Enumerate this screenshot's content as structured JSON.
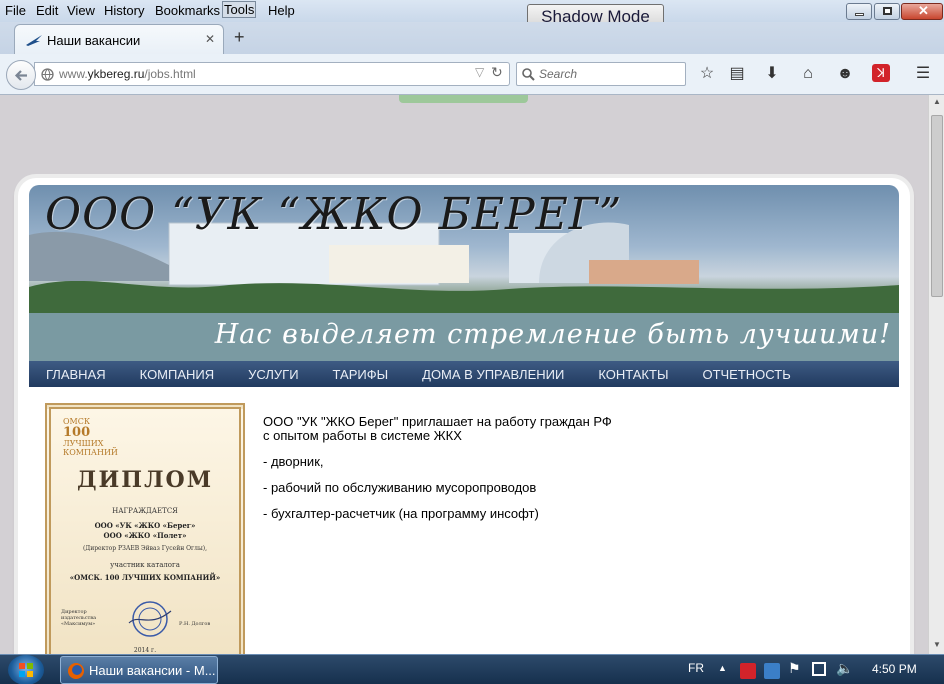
{
  "menu": {
    "items": [
      "File",
      "Edit",
      "View",
      "History",
      "Bookmarks",
      "Tools",
      "Help"
    ],
    "selected": "Tools"
  },
  "shadow_mode_label": "Shadow Mode",
  "tab": {
    "title": "Наши вакансии",
    "new_tab": "+"
  },
  "nav": {
    "url_prefix": "www.",
    "url_domain": "ykbereg.ru",
    "url_path": "/jobs.html",
    "search_placeholder": "Search"
  },
  "site": {
    "company_name": "ООО “УК “ЖКО БЕРЕГ”",
    "slogan": "Нас выделяет стремление быть лучшими!",
    "menu": [
      "ГЛАВНАЯ",
      "КОМПАНИЯ",
      "УСЛУГИ",
      "ТАРИФЫ",
      "ДОМА В УПРАВЛЕНИИ",
      "КОНТАКТЫ",
      "ОТЧЕТНОСТЬ"
    ],
    "diploma": {
      "badge_top": "ОМСК",
      "badge_number": "100",
      "badge_sub": "ЛУЧШИХ КОМПАНИЙ",
      "heading": "ДИПЛОМ",
      "awarded": "НАГРАЖДАЕТСЯ",
      "company1": "ООО «УК «ЖКО «Берег»",
      "company2": "ООО «ЖКО «Полет»",
      "director": "(Директор РЗАЕВ Эйваз Гусейн Оглы),",
      "participant": "участник каталога",
      "catalog": "«ОМСК. 100 ЛУЧШИХ КОМПАНИЙ»",
      "signer": "Директор издательства «Максимум»",
      "signer_name": "Р.Н. Долгов",
      "year": "2014 г."
    },
    "intro_line1": "ООО \"УК \"ЖКО Берег\" приглашает на работу граждан РФ",
    "intro_line2": "с опытом работы в системе ЖКХ",
    "vacancies": [
      "- дворник,",
      "- рабочий по обслуживанию мусоропроводов",
      "- бухгалтер-расчетчик (на программу инсофт)"
    ]
  },
  "taskbar": {
    "task_label": "Наши вакансии - М...",
    "language": "FR",
    "time": "4:50 PM"
  },
  "colors": {
    "nav_bg": "#2c4670",
    "page_bg": "#d3d0d4",
    "window_chrome": "#cfdbea"
  },
  "icons": [
    "firefox-icon",
    "back-arrow-icon",
    "globe-icon",
    "dropdown-icon",
    "reload-icon",
    "search-icon",
    "star-icon",
    "reading-list-icon",
    "download-icon",
    "home-icon",
    "smiley-icon",
    "avira-icon",
    "hamburger-icon",
    "windows-start-icon"
  ]
}
